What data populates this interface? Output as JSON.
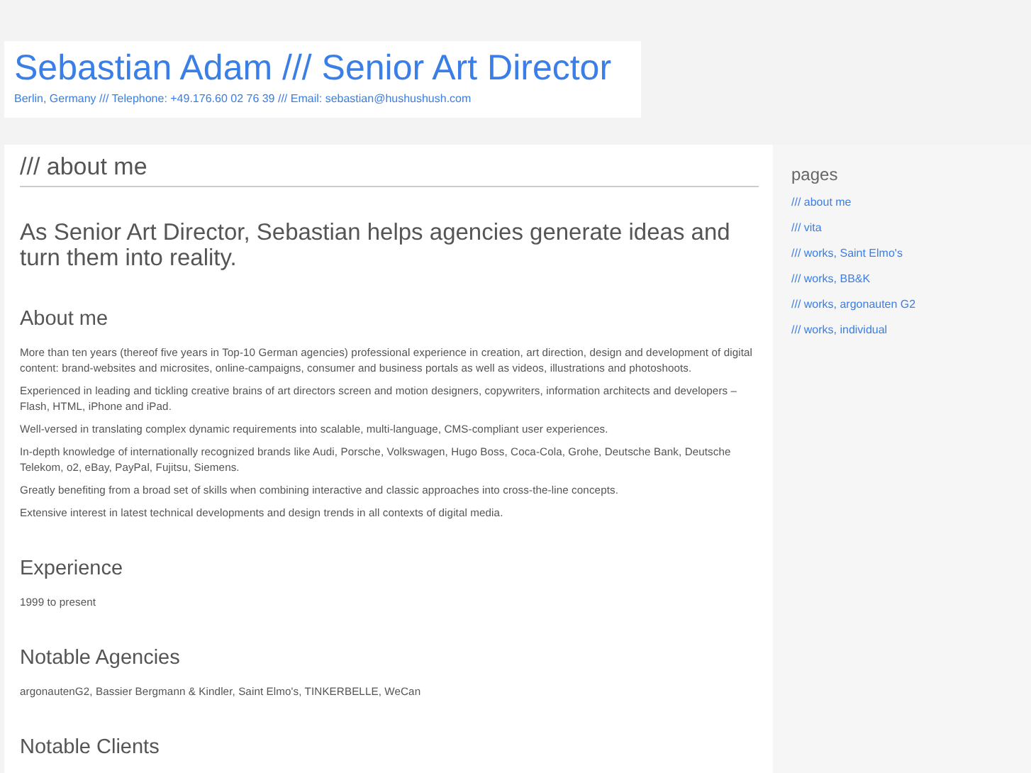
{
  "header": {
    "title": "Sebastian Adam /// Senior Art Director",
    "contact": "Berlin, Germany /// Telephone: +49.176.60 02 76 39 /// Email: sebastian@hushushush.com"
  },
  "main": {
    "page_title": "/// about me",
    "lead": "As Senior Art Director, Sebastian helps agencies generate ideas and turn them into reality.",
    "sections": [
      {
        "heading": "About me",
        "paragraphs": [
          "More than ten years (thereof five years in Top-10 German agencies) professional experience in creation, art direction, design and development of digital content: brand-websites and microsites, online-campaigns, consumer and business portals as well as videos, illustrations and photoshoots.",
          "Experienced in leading and tickling creative brains of art directors screen and motion designers, copywriters, information architects and developers – Flash, HTML, iPhone and iPad.",
          "Well-versed in translating complex dynamic requirements into scalable, multi-language, CMS-compliant user experiences.",
          "In-depth knowledge of internationally recognized brands like Audi, Porsche, Volkswagen, Hugo Boss, Coca-Cola, Grohe, Deutsche Bank, Deutsche Telekom, o2, eBay, PayPal, Fujitsu, Siemens.",
          "Greatly benefiting from a broad set of skills when combining interactive and classic approaches into cross-the-line concepts.",
          "Extensive interest in latest technical developments and design trends in all contexts of digital media."
        ]
      },
      {
        "heading": "Experience",
        "paragraphs": [
          "1999 to present"
        ]
      },
      {
        "heading": "Notable Agencies",
        "paragraphs": [
          "argonautenG2, Bassier Bergmann & Kindler, Saint Elmo's, TINKERBELLE, WeCan"
        ]
      },
      {
        "heading": "Notable Clients"
      }
    ]
  },
  "sidebar": {
    "title": "pages",
    "links": [
      "/// about me",
      "/// vita",
      "/// works, Saint Elmo's",
      "/// works, BB&K",
      "/// works, argonauten G2",
      "/// works, individual"
    ]
  }
}
